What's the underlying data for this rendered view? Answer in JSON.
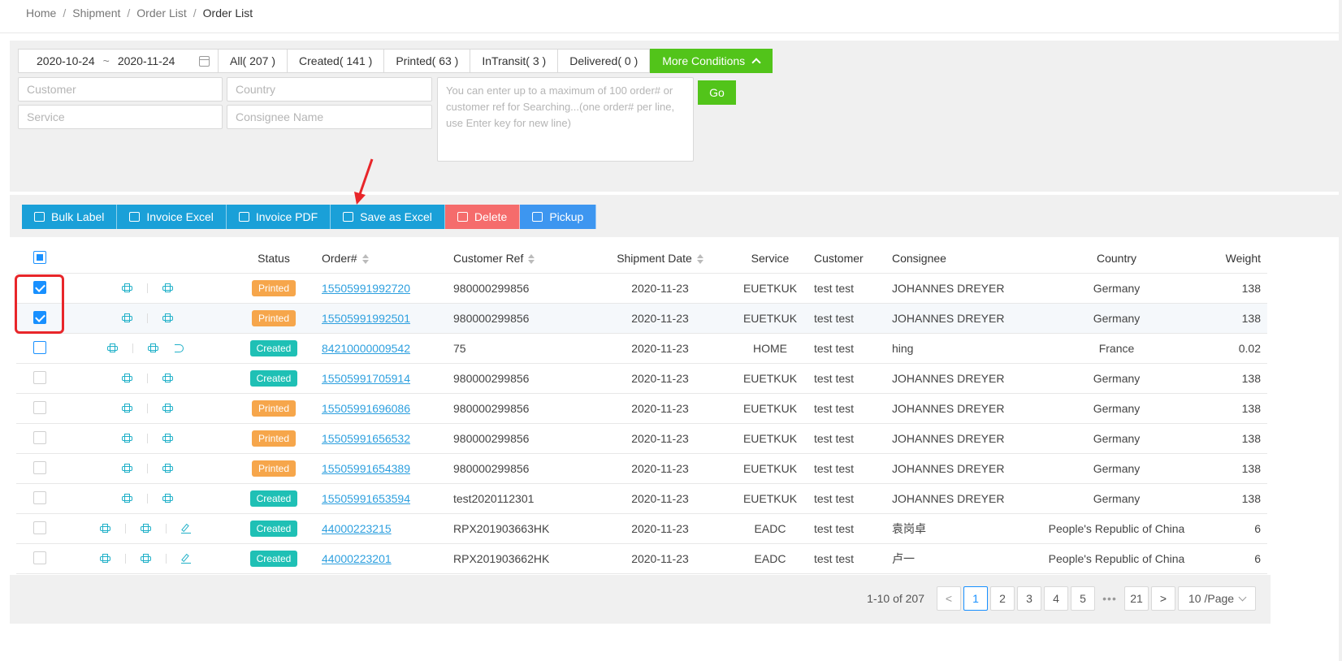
{
  "breadcrumb": [
    "Home",
    "Shipment",
    "Order List",
    "Order List"
  ],
  "filters": {
    "date_start": "2020-10-24",
    "date_sep": "~",
    "date_end": "2020-11-24",
    "tabs": [
      "All( 207 )",
      "Created( 141 )",
      "Printed( 63 )",
      "InTransit( 3 )",
      "Delivered( 0 )"
    ],
    "more_label": "More Conditions",
    "customer_ph": "Customer",
    "country_ph": "Country",
    "service_ph": "Service",
    "consignee_ph": "Consignee Name",
    "orders_ph": "You can enter up to a maximum of 100 order# or customer ref for Searching...(one order# per line, use Enter key for new line)",
    "go_label": "Go"
  },
  "actions": [
    "Bulk Label",
    "Invoice Excel",
    "Invoice PDF",
    "Save as Excel",
    "Delete",
    "Pickup"
  ],
  "columns": {
    "status": "Status",
    "order": "Order#",
    "ref": "Customer Ref",
    "date": "Shipment Date",
    "service": "Service",
    "customer": "Customer",
    "consignee": "Consignee",
    "country": "Country",
    "weight": "Weight"
  },
  "rows": [
    {
      "checked": true,
      "status": "Printed",
      "order": "15505991992720",
      "ref": "980000299856",
      "date": "2020-11-23",
      "service": "EUETKUK",
      "customer": "test test",
      "consignee": "JOHANNES DREYER",
      "country": "Germany",
      "weight": "138",
      "icons": "pp"
    },
    {
      "checked": true,
      "status": "Printed",
      "order": "15505991992501",
      "ref": "980000299856",
      "date": "2020-11-23",
      "service": "EUETKUK",
      "customer": "test test",
      "consignee": "JOHANNES DREYER",
      "country": "Germany",
      "weight": "138",
      "icons": "pp"
    },
    {
      "checked": false,
      "status": "Created",
      "order": "84210000009542",
      "ref": "75",
      "date": "2020-11-23",
      "service": "HOME",
      "customer": "test test",
      "consignee": "hing",
      "country": "France",
      "weight": "0.02",
      "icons": "ppu"
    },
    {
      "checked": false,
      "status": "Created",
      "order": "15505991705914",
      "ref": "980000299856",
      "date": "2020-11-23",
      "service": "EUETKUK",
      "customer": "test test",
      "consignee": "JOHANNES DREYER",
      "country": "Germany",
      "weight": "138",
      "icons": "pp"
    },
    {
      "checked": false,
      "status": "Printed",
      "order": "15505991696086",
      "ref": "980000299856",
      "date": "2020-11-23",
      "service": "EUETKUK",
      "customer": "test test",
      "consignee": "JOHANNES DREYER",
      "country": "Germany",
      "weight": "138",
      "icons": "pp"
    },
    {
      "checked": false,
      "status": "Printed",
      "order": "15505991656532",
      "ref": "980000299856",
      "date": "2020-11-23",
      "service": "EUETKUK",
      "customer": "test test",
      "consignee": "JOHANNES DREYER",
      "country": "Germany",
      "weight": "138",
      "icons": "pp"
    },
    {
      "checked": false,
      "status": "Printed",
      "order": "15505991654389",
      "ref": "980000299856",
      "date": "2020-11-23",
      "service": "EUETKUK",
      "customer": "test test",
      "consignee": "JOHANNES DREYER",
      "country": "Germany",
      "weight": "138",
      "icons": "pp"
    },
    {
      "checked": false,
      "status": "Created",
      "order": "15505991653594",
      "ref": "test2020112301",
      "date": "2020-11-23",
      "service": "EUETKUK",
      "customer": "test test",
      "consignee": "JOHANNES DREYER",
      "country": "Germany",
      "weight": "138",
      "icons": "pp"
    },
    {
      "checked": false,
      "status": "Created",
      "order": "44000223215",
      "ref": "RPX201903663HK",
      "date": "2020-11-23",
      "service": "EADC",
      "customer": "test test",
      "consignee": "袁岗卓",
      "country": "People's Republic of China",
      "weight": "6",
      "icons": "ppe"
    },
    {
      "checked": false,
      "status": "Created",
      "order": "44000223201",
      "ref": "RPX201903662HK",
      "date": "2020-11-23",
      "service": "EADC",
      "customer": "test test",
      "consignee": "卢一",
      "country": "People's Republic of China",
      "weight": "6",
      "icons": "ppe"
    }
  ],
  "pagination": {
    "total": "1-10 of 207",
    "pages": [
      "1",
      "2",
      "3",
      "4",
      "5"
    ],
    "ellipsis": "•••",
    "last": "21",
    "prev": "<",
    "next": ">",
    "page_size": "10 /Page"
  },
  "colors": {
    "printed": "#f6a64b",
    "created": "#1fc0b5",
    "green": "#52c41a",
    "action_blue": "#1aa0d8",
    "delete_red": "#f56c6c",
    "pickup_blue": "#3d96f0",
    "annotation_red": "#e8262a"
  }
}
